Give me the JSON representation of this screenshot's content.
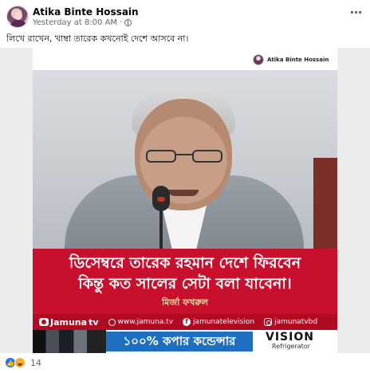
{
  "post": {
    "author": "Atika Binte Hossain",
    "timestamp": "Yesterday at 8:00 AM",
    "separator": "·",
    "more_glyph": "···",
    "caption": "লিখে রাখেন, খাম্বা তারেক কখনোই দেশে আসবে না।"
  },
  "image": {
    "watermark_name": "Atika Binte Hossain",
    "headline_line1": "ডিসেম্বরে তারেক রহমান দেশে ফিরবেন",
    "headline_line2": "কিন্তু কত সালের সেটা বলা যাবেনা।",
    "speaker": "মির্জা ফখরুল",
    "footer": {
      "logo": "Jamuna",
      "logo_suffix": "tv",
      "website": "www.jamuna.tv",
      "facebook": "jamunatelevision",
      "instagram": "jamunatvbd"
    },
    "ad": {
      "banner": "১০০% কপার কন্ডেন্সার",
      "brand": "VISION",
      "sub": "Refrigerator"
    }
  },
  "reactions": {
    "count": "14",
    "types": [
      "like-icon",
      "haha-icon"
    ]
  },
  "colors": {
    "headline_red": "#c8102e",
    "footer_red": "#b10b24",
    "link_blue": "#1877f2",
    "ad_blue": "#1f6fc1"
  }
}
